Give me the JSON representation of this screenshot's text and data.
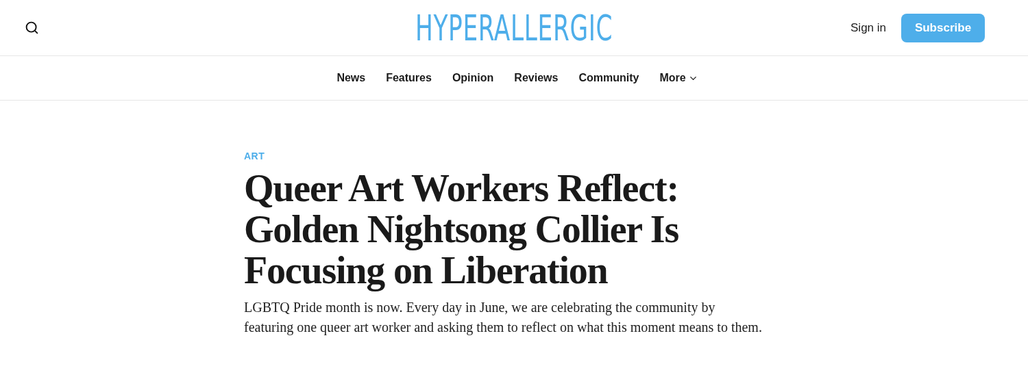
{
  "header": {
    "logo": "HYPERALLERGIC",
    "sign_in": "Sign in",
    "subscribe": "Subscribe"
  },
  "nav": [
    {
      "label": "News",
      "has_menu": false
    },
    {
      "label": "Features",
      "has_menu": false
    },
    {
      "label": "Opinion",
      "has_menu": false
    },
    {
      "label": "Reviews",
      "has_menu": false
    },
    {
      "label": "Community",
      "has_menu": false
    },
    {
      "label": "More",
      "has_menu": true
    }
  ],
  "article": {
    "category": "ART",
    "title": "Queer Art Workers Reflect: Golden Nightsong Collier Is Focusing on Liberation",
    "lede": "LGBTQ Pride month is now. Every day in June, we are celebrating the community by featuring one queer art worker and asking them to reflect on what this moment means to them."
  }
}
